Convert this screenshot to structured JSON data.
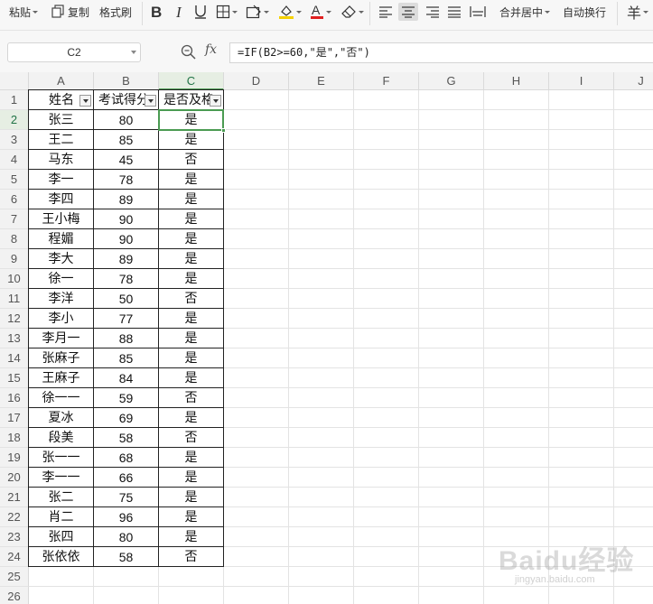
{
  "toolbar": {
    "paste_label": "粘贴",
    "copy_label": "复制",
    "format_painter_label": "格式刷",
    "merge_center_label": "合并居中",
    "wrap_text_label": "自动换行",
    "currency_label": "羊"
  },
  "formula_bar": {
    "name_box": "C2",
    "fx_label": "fx",
    "formula": "=IF(B2>=60,\"是\",\"否\")"
  },
  "grid": {
    "columns": [
      "A",
      "B",
      "C",
      "D",
      "E",
      "F",
      "G",
      "H",
      "I",
      "J"
    ],
    "row_numbers": [
      "1",
      "2",
      "3",
      "4",
      "5",
      "6",
      "7",
      "8",
      "9",
      "10",
      "11",
      "12",
      "13",
      "14",
      "15",
      "16",
      "17",
      "18",
      "19",
      "20",
      "21",
      "22",
      "23",
      "24",
      "25",
      "26"
    ],
    "active_cell": "C2",
    "headers": [
      "姓名",
      "考试得分",
      "是否及格"
    ],
    "rows": [
      [
        "张三",
        "80",
        "是"
      ],
      [
        "王二",
        "85",
        "是"
      ],
      [
        "马东",
        "45",
        "否"
      ],
      [
        "李一",
        "78",
        "是"
      ],
      [
        "李四",
        "89",
        "是"
      ],
      [
        "王小梅",
        "90",
        "是"
      ],
      [
        "程媚",
        "90",
        "是"
      ],
      [
        "李大",
        "89",
        "是"
      ],
      [
        "徐一",
        "78",
        "是"
      ],
      [
        "李洋",
        "50",
        "否"
      ],
      [
        "李小",
        "77",
        "是"
      ],
      [
        "李月一",
        "88",
        "是"
      ],
      [
        "张麻子",
        "85",
        "是"
      ],
      [
        "王麻子",
        "84",
        "是"
      ],
      [
        "徐一一",
        "59",
        "否"
      ],
      [
        "夏冰",
        "69",
        "是"
      ],
      [
        "段美",
        "58",
        "否"
      ],
      [
        "张一一",
        "68",
        "是"
      ],
      [
        "李一一",
        "66",
        "是"
      ],
      [
        "张二",
        "75",
        "是"
      ],
      [
        "肖二",
        "96",
        "是"
      ],
      [
        "张四",
        "80",
        "是"
      ],
      [
        "张依依",
        "58",
        "否"
      ]
    ]
  },
  "watermark": {
    "text": "Baidu经验",
    "sub": "jingyan.baidu.com"
  }
}
